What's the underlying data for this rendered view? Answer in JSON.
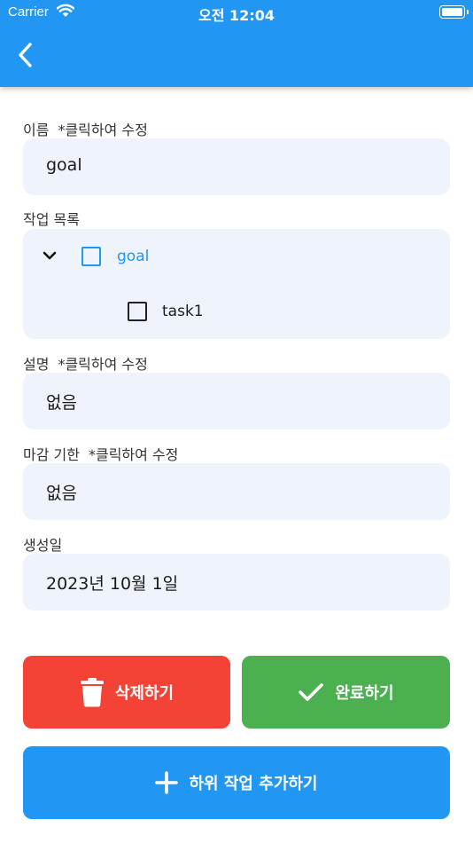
{
  "status_bar": {
    "carrier": "Carrier",
    "time": "오전 12:04"
  },
  "header": {
    "back_icon": "chevron-left-icon"
  },
  "name": {
    "label": "이름",
    "hint": "*클릭하여 수정",
    "value": "goal"
  },
  "tasks": {
    "label": "작업 목록",
    "root": {
      "label": "goal",
      "checked": false,
      "expanded": true
    },
    "children": [
      {
        "label": "task1",
        "checked": false
      }
    ]
  },
  "description": {
    "label": "설명",
    "hint": "*클릭하여 수정",
    "value": "없음"
  },
  "deadline": {
    "label": "마감 기한",
    "hint": "*클릭하여 수정",
    "value": "없음"
  },
  "created": {
    "label": "생성일",
    "value": "2023년 10월 1일"
  },
  "actions": {
    "delete_label": "삭제하기",
    "complete_label": "완료하기",
    "add_subtask_label": "하위 작업 추가하기"
  },
  "colors": {
    "primary": "#2196f3",
    "delete": "#f44336",
    "complete": "#4caf50",
    "field_bg": "#eff4fc"
  }
}
